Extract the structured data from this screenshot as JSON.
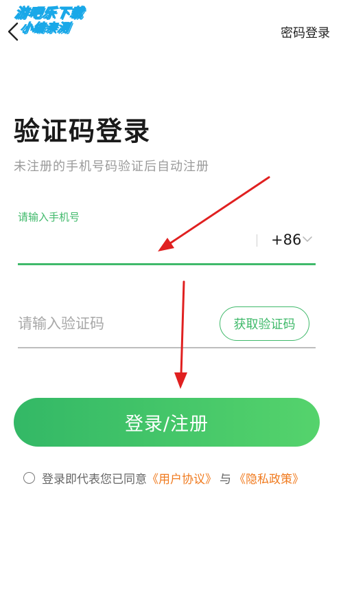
{
  "watermark": {
    "line1": "游吧乐下载",
    "line2": "小编亲测"
  },
  "header": {
    "back_icon": "chevron-left-icon",
    "password_login": "密码登录"
  },
  "title": "验证码登录",
  "subtitle": "未注册的手机号码验证后自动注册",
  "phone": {
    "label": "请输入手机号",
    "value": "",
    "country_code": "+86",
    "dropdown_icon": "chevron-down-icon"
  },
  "code": {
    "placeholder": "请输入验证码",
    "value": "",
    "get_code_label": "获取验证码"
  },
  "login_button": "登录/注册",
  "agreement": {
    "prefix": "登录即代表您已同意",
    "user_agreement": "《用户协议》",
    "conjunction": "与",
    "privacy_policy": "《隐私政策》",
    "checked": false
  },
  "colors": {
    "accent": "#3fb96a",
    "link": "#f07a1e",
    "annotation_arrow": "#e02020"
  }
}
